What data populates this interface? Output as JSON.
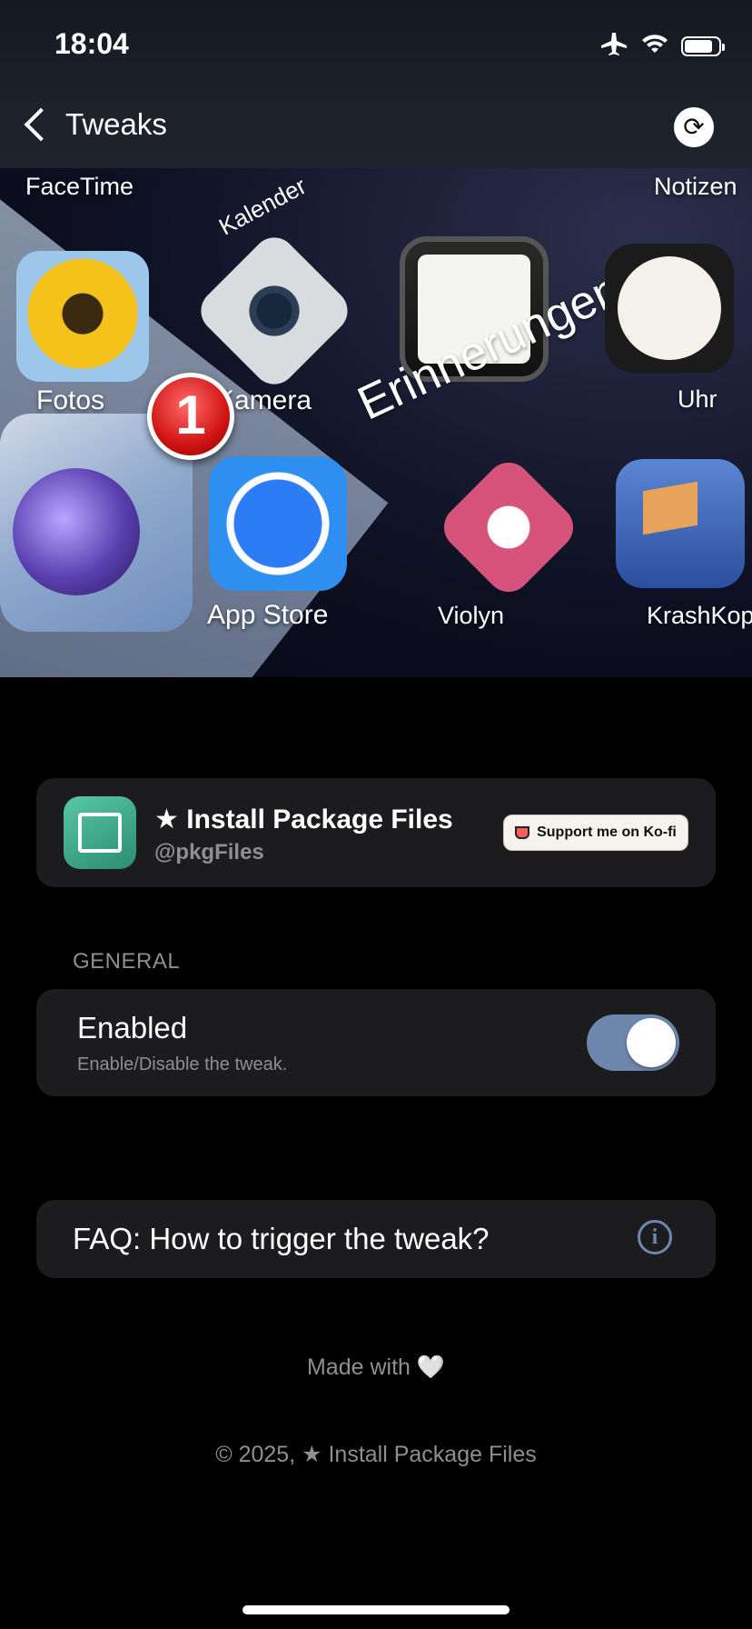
{
  "status_bar": {
    "time": "18:04",
    "icons": [
      "airplane-icon",
      "wifi-icon",
      "battery-icon"
    ]
  },
  "nav": {
    "back_label": "Tweaks",
    "refresh_icon": "refresh-icon"
  },
  "banner": {
    "labels": {
      "facetime": "FaceTime",
      "kalender": "Kalender",
      "notizen": "Notizen",
      "fotos": "Fotos",
      "kamera": "Kamera",
      "erinnerungen": "Erinnerungen",
      "uhr": "Uhr",
      "appstore": "App Store",
      "violyn": "Violyn",
      "krashkop": "KrashKop"
    },
    "badge_count": "1"
  },
  "package": {
    "title": "★ Install Package Files",
    "handle": "@pkgFiles",
    "kofi_label": "Support me on Ko-fi"
  },
  "general": {
    "section_label": "GENERAL",
    "enabled_title": "Enabled",
    "enabled_subtitle": "Enable/Disable the tweak.",
    "enabled_state": true
  },
  "faq": {
    "label": "FAQ: How to trigger the tweak?"
  },
  "footer": {
    "made_with": "Made with 🤍",
    "copyright": "© 2025, ★ Install Package Files"
  },
  "colors": {
    "accent": "#6e87ad",
    "card_bg": "#1c1c1e",
    "secondary_text": "#8e8e93"
  }
}
